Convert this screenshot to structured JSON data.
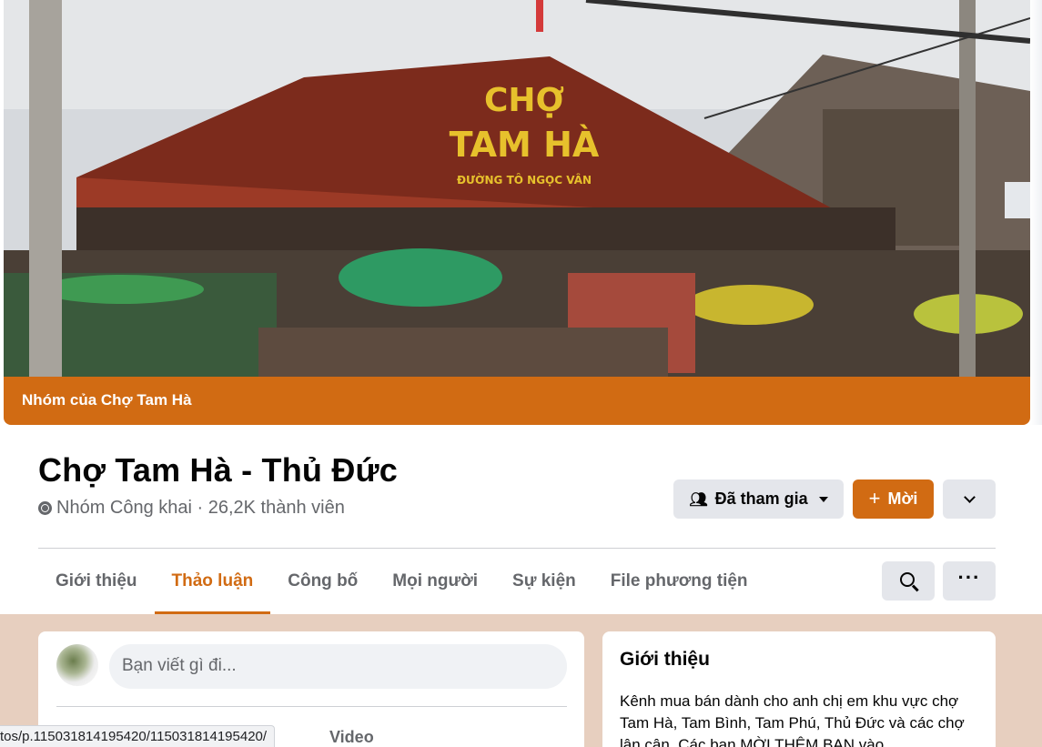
{
  "cover": {
    "sign_line1": "CHỢ",
    "sign_line2": "TAM HÀ",
    "sign_line3": "ĐƯỜNG TÔ NGỌC VÂN",
    "caption": "Nhóm của Chợ Tam Hà",
    "accent_color": "#d16b13"
  },
  "header": {
    "title": "Chợ Tam Hà - Thủ Đức",
    "meta": "Nhóm Công khai · 26,2K thành viên",
    "meta_icon": "globe-icon"
  },
  "actions": {
    "joined_label": "Đã tham gia",
    "joined_icon": "people-icon",
    "invite_label": "Mời",
    "invite_icon": "plus-icon",
    "more_icon": "chevron-down-icon"
  },
  "tabs": [
    {
      "label": "Giới thiệu",
      "active": false
    },
    {
      "label": "Thảo luận",
      "active": true
    },
    {
      "label": "Công bố",
      "active": false
    },
    {
      "label": "Mọi người",
      "active": false
    },
    {
      "label": "Sự kiện",
      "active": false
    },
    {
      "label": "File phương tiện",
      "active": false
    }
  ],
  "toolbar": {
    "search_icon": "search-icon",
    "more_icon": "more-dots-icon"
  },
  "composer": {
    "placeholder": "Bạn viết gì đi...",
    "video_label": "Video"
  },
  "about": {
    "title": "Giới thiệu",
    "text": "Kênh mua bán dành cho anh chị em khu vực chợ Tam Hà, Tam Bình, Tam Phú, Thủ Đức và các chợ lân cận. Các bạn MỜI THÊM BẠN vào"
  },
  "status_bar": {
    "url": "tos/p.115031814195420/115031814195420/"
  }
}
